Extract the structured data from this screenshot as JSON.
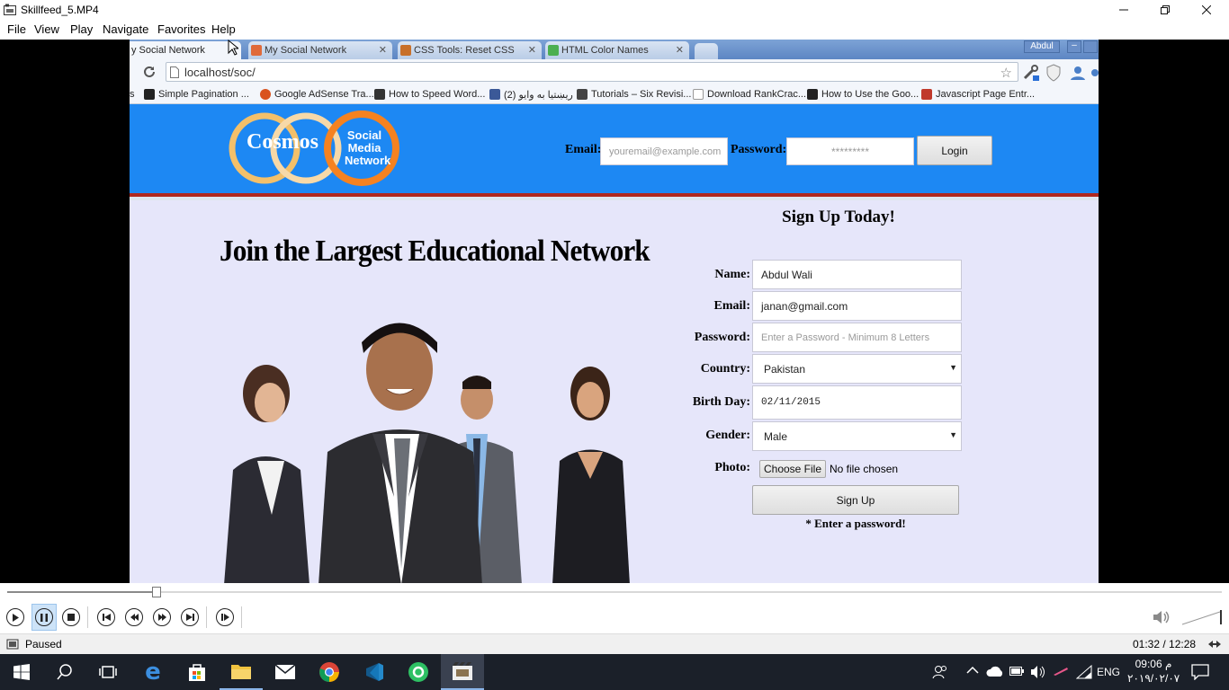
{
  "window": {
    "title": "Skillfeed_5.MP4"
  },
  "menu": [
    "File",
    "View",
    "Play",
    "Navigate",
    "Favorites",
    "Help"
  ],
  "browser": {
    "tabs": [
      {
        "label": "y Social Network",
        "active": true
      },
      {
        "label": "My Social Network",
        "active": false
      },
      {
        "label": "CSS Tools: Reset CSS",
        "active": false
      },
      {
        "label": "HTML Color Names",
        "active": false
      }
    ],
    "user": "Abdul",
    "url": "localhost/soc/",
    "bookmarks": [
      "Simple Pagination ...",
      "Google AdSense Tra...",
      "How to Speed Word...",
      "(2) ريښتيا به وايو",
      "Tutorials – Six Revisi...",
      "Download RankCrac...",
      "How to Use the Goo...",
      "Javascript Page Entr..."
    ]
  },
  "site": {
    "logo_main": "Cosmos",
    "logo_sub": [
      "Social",
      "Media",
      "Network"
    ],
    "login": {
      "email_label": "Email:",
      "email_placeholder": "youremail@example.com",
      "password_label": "Password:",
      "password_placeholder": "*********",
      "button": "Login"
    },
    "headline": "Join the Largest Educational Network",
    "signup": {
      "title": "Sign Up Today!",
      "name_label": "Name:",
      "name_value": "Abdul Wali",
      "email_label": "Email:",
      "email_value": "janan@gmail.com",
      "password_label": "Password:",
      "password_placeholder": "Enter a Password - Minimum 8 Letters",
      "country_label": "Country:",
      "country_value": "Pakistan",
      "birthday_label": "Birth Day:",
      "birthday_value": "02/11/2015",
      "gender_label": "Gender:",
      "gender_value": "Male",
      "photo_label": "Photo:",
      "photo_button": "Choose File",
      "photo_status": "No file chosen",
      "submit": "Sign Up",
      "error": "* Enter a password!"
    }
  },
  "player": {
    "status": "Paused",
    "time": "01:32 / 12:28",
    "progress": 0.123
  },
  "taskbar": {
    "lang": "ENG",
    "clock_time": "09:06 م",
    "clock_date": "٢٠١٩/٠٢/٠٧"
  }
}
